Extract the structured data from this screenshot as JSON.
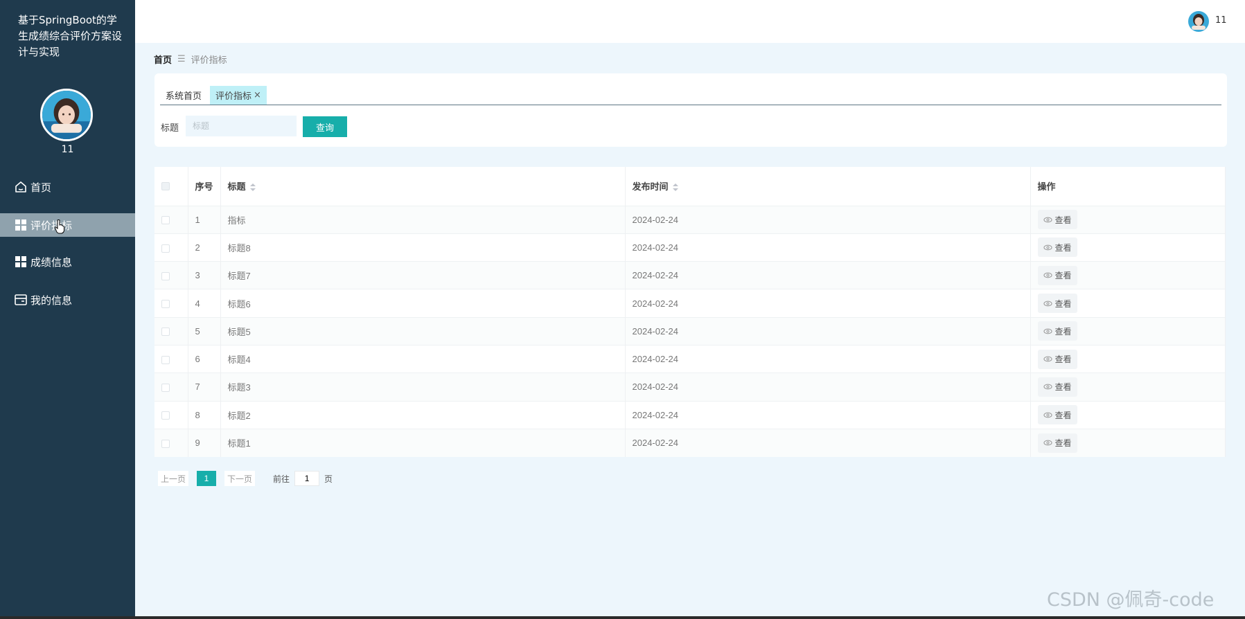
{
  "sidebar": {
    "title": "基于SpringBoot的学生成绩综合评价方案设计与实现",
    "username": "11",
    "items": [
      {
        "label": "首页",
        "icon": "home-icon"
      },
      {
        "label": "评价指标",
        "icon": "grid-icon"
      },
      {
        "label": "成绩信息",
        "icon": "grid-icon"
      },
      {
        "label": "我的信息",
        "icon": "card-icon"
      }
    ]
  },
  "header": {
    "username": "11"
  },
  "breadcrumb": {
    "home": "首页",
    "separator": "☰",
    "current": "评价指标"
  },
  "tabs": [
    {
      "label": "系统首页"
    },
    {
      "label": "评价指标",
      "close": "×"
    }
  ],
  "search": {
    "label": "标题",
    "placeholder": "标题",
    "button": "查询"
  },
  "table": {
    "headers": {
      "index": "序号",
      "title": "标题",
      "publish_time": "发布时间",
      "actions": "操作"
    },
    "view_label": "查看",
    "rows": [
      {
        "index": "1",
        "title": "指标",
        "date": "2024-02-24"
      },
      {
        "index": "2",
        "title": "标题8",
        "date": "2024-02-24"
      },
      {
        "index": "3",
        "title": "标题7",
        "date": "2024-02-24"
      },
      {
        "index": "4",
        "title": "标题6",
        "date": "2024-02-24"
      },
      {
        "index": "5",
        "title": "标题5",
        "date": "2024-02-24"
      },
      {
        "index": "6",
        "title": "标题4",
        "date": "2024-02-24"
      },
      {
        "index": "7",
        "title": "标题3",
        "date": "2024-02-24"
      },
      {
        "index": "8",
        "title": "标题2",
        "date": "2024-02-24"
      },
      {
        "index": "9",
        "title": "标题1",
        "date": "2024-02-24"
      }
    ]
  },
  "pagination": {
    "prev": "上一页",
    "current": "1",
    "next": "下一页",
    "goto": "前往",
    "page_value": "1",
    "unit": "页"
  },
  "watermark": "CSDN @佩奇-code",
  "colors": {
    "sidebar_bg": "#1f3a4d",
    "accent": "#17aeaa",
    "page_bg": "#edf6fc",
    "active_tab": "#bff0f7"
  }
}
